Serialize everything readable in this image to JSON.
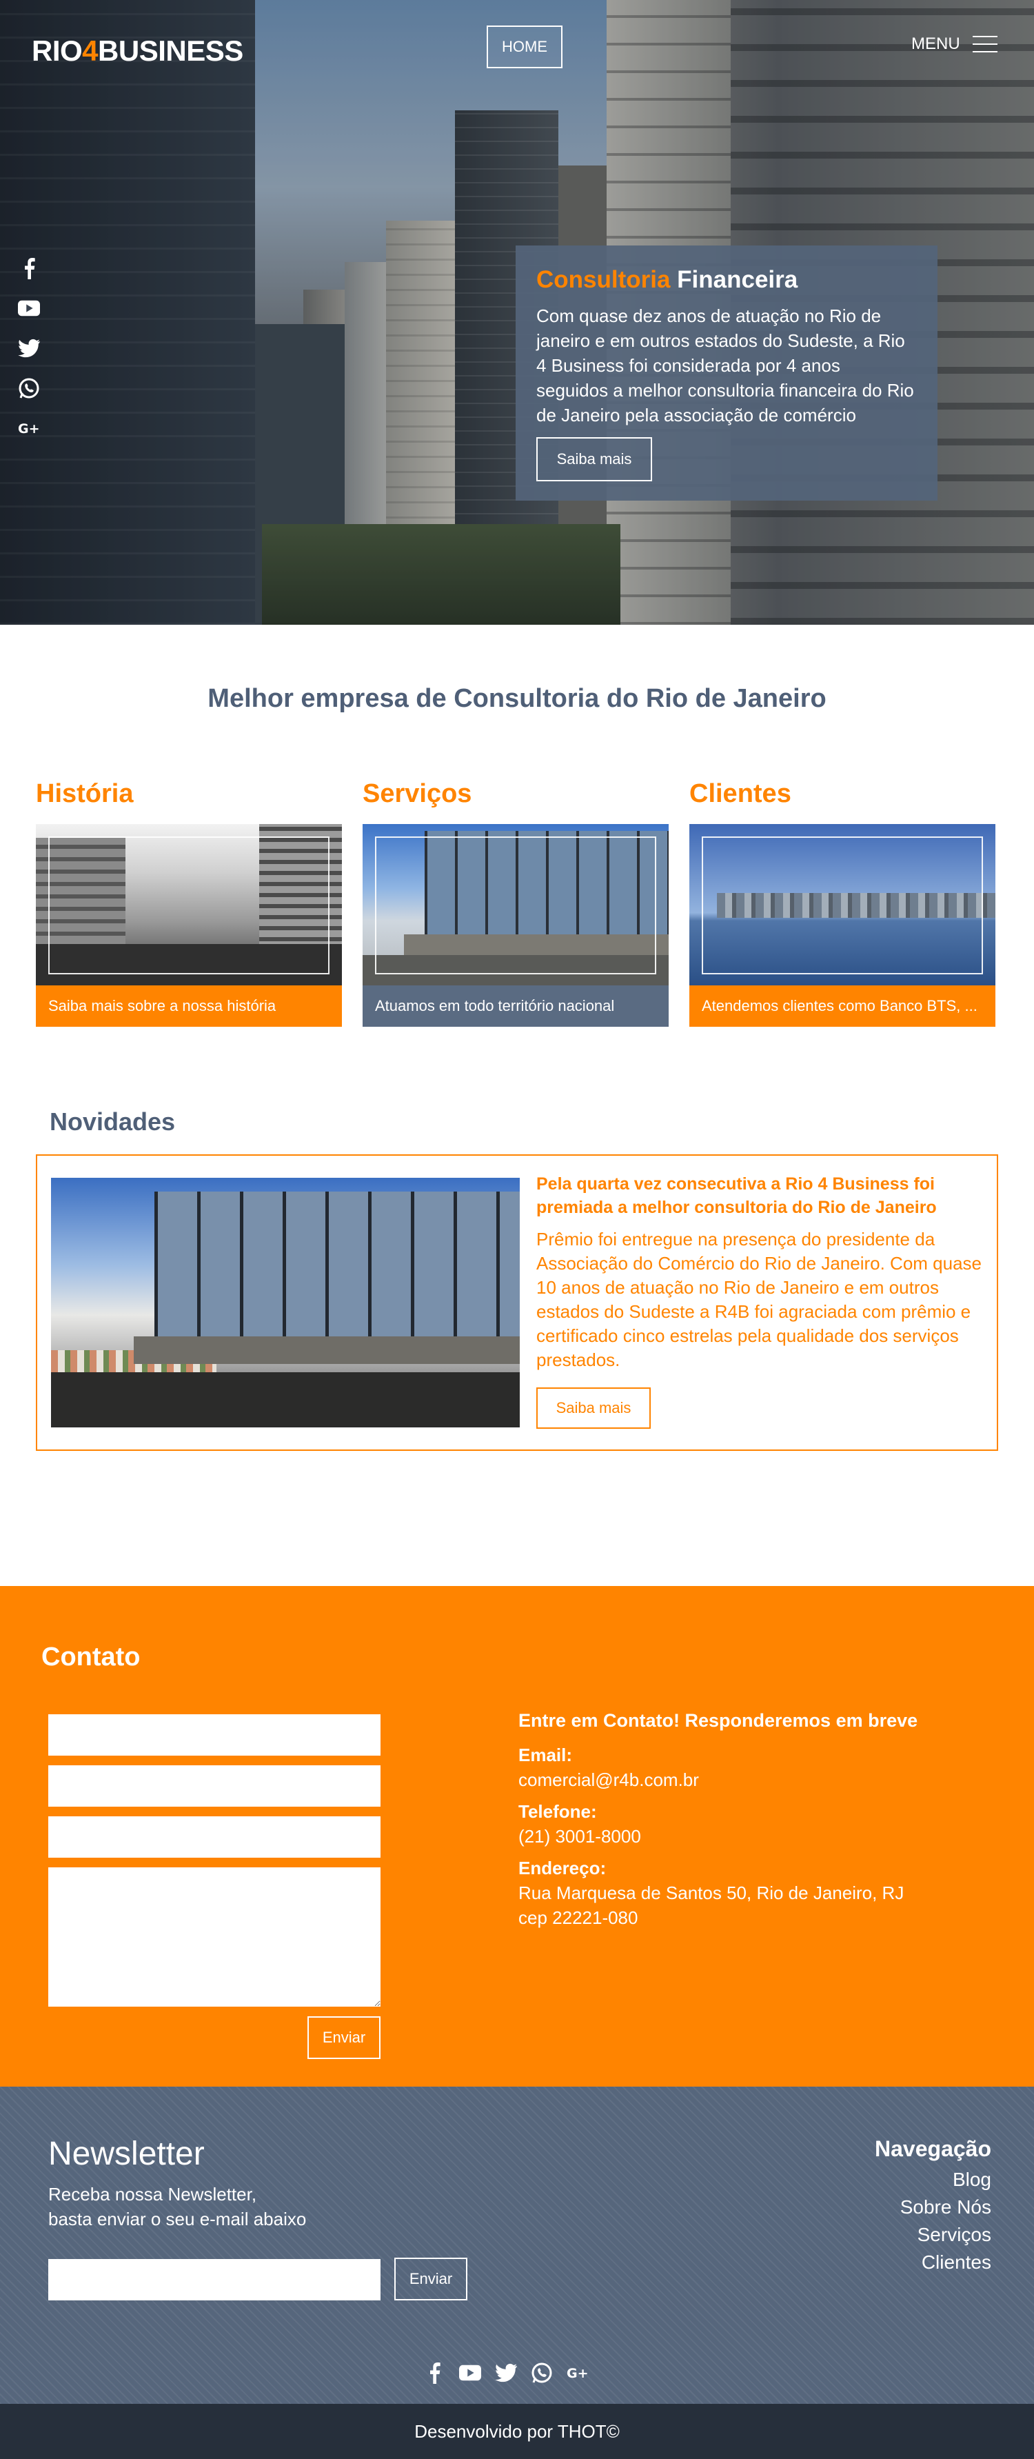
{
  "colors": {
    "accent": "#ff8400",
    "slate": "#56667c",
    "dark": "#262f3b",
    "text": "#4f5f77"
  },
  "header": {
    "logo_part1": "RIO",
    "logo_part2": "4",
    "logo_part3": "BUSINESS",
    "home_label": "HOME",
    "menu_label": "MENU"
  },
  "hero": {
    "title_accent": "Consultoria",
    "title_rest": " Financeira",
    "text": "Com quase dez anos de atuação no Rio de janeiro e em outros estados do Sudeste, a Rio 4 Business foi considerada por 4 anos seguidos a melhor consultoria financeira do Rio de Janeiro pela associação de comércio",
    "button_label": "Saiba mais"
  },
  "social_icons": [
    "facebook-icon",
    "youtube-icon",
    "twitter-icon",
    "whatsapp-icon",
    "google-plus-icon"
  ],
  "intro": {
    "tagline": "Melhor empresa de Consultoria do Rio de Janeiro",
    "columns": [
      {
        "title": "História",
        "caption": "Saiba mais sobre a nossa história"
      },
      {
        "title": "Serviços",
        "caption": "Atuamos em todo território nacional"
      },
      {
        "title": "Clientes",
        "caption": "Atendemos clientes como Banco BTS, ..."
      }
    ]
  },
  "news": {
    "section_title": "Novidades",
    "headline": "Pela quarta vez consecutiva a Rio 4 Business foi premiada a melhor consultoria do Rio de Janeiro",
    "body": "Prêmio foi entregue na presença do presidente da Associação do Comércio do Rio de Janeiro. Com quase 10 anos de atuação no Rio de Janeiro e em outros estados do Sudeste a R4B foi agraciada com prêmio e certificado cinco estrelas pela qualidade dos serviços prestados.",
    "button_label": "Saiba mais"
  },
  "contact": {
    "title": "Contato",
    "send_label": "Enviar",
    "info_heading": "Entre em Contato! Responderemos em breve",
    "email_label": "Email:",
    "email_value": "comercial@r4b.com.br",
    "phone_label": "Telefone:",
    "phone_value": "(21) 3001-8000",
    "address_label": "Endereço:",
    "address_line1": "Rua Marquesa de Santos 50, Rio de Janeiro, RJ",
    "address_line2": "cep 22221-080"
  },
  "newsletter": {
    "title": "Newsletter",
    "subtitle_line1": "Receba nossa Newsletter,",
    "subtitle_line2": "basta enviar o seu e-mail abaixo",
    "send_label": "Enviar"
  },
  "footer_nav": {
    "heading": "Navegação",
    "items": [
      "Blog",
      "Sobre Nós",
      "Serviços",
      "Clientes"
    ]
  },
  "credits": "Desenvolvido por THOT©"
}
